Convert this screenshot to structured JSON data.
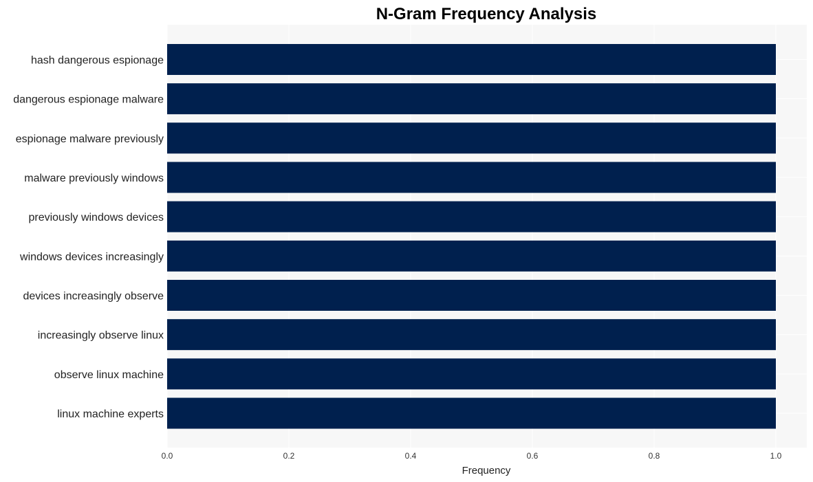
{
  "chart_data": {
    "type": "bar",
    "orientation": "horizontal",
    "title": "N-Gram Frequency Analysis",
    "xlabel": "Frequency",
    "ylabel": "",
    "xlim": [
      0,
      1.05
    ],
    "xticks": [
      "0.0",
      "0.2",
      "0.4",
      "0.6",
      "0.8",
      "1.0"
    ],
    "xtick_values": [
      0,
      0.2,
      0.4,
      0.6,
      0.8,
      1.0
    ],
    "grid": true,
    "bar_color": "#00204e",
    "background_color": "#f7f7f7",
    "categories": [
      "hash dangerous espionage",
      "dangerous espionage malware",
      "espionage malware previously",
      "malware previously windows",
      "previously windows devices",
      "windows devices increasingly",
      "devices increasingly observe",
      "increasingly observe linux",
      "observe linux machine",
      "linux machine experts"
    ],
    "values": [
      1,
      1,
      1,
      1,
      1,
      1,
      1,
      1,
      1,
      1
    ]
  }
}
